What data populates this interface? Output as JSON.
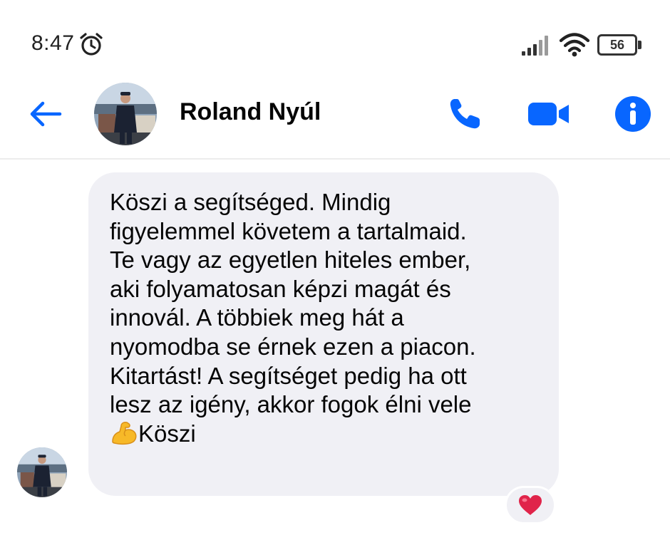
{
  "status_bar": {
    "time": "8:47",
    "battery": "56",
    "icons": [
      "alarm-icon",
      "signal-icon",
      "wifi-icon",
      "battery-icon"
    ]
  },
  "header": {
    "contact_name": "Roland Nyúl",
    "icons": [
      "back-arrow-icon",
      "phone-icon",
      "video-camera-icon",
      "info-icon"
    ],
    "accent_color": "#0866ff"
  },
  "message": {
    "lines": [
      "Köszi a segítséged. Mindig",
      "figyelemmel követem a tartalmaid.",
      "Te vagy az egyetlen hiteles ember,",
      "aki folyamatosan képzi magát és",
      "innovál. A többiek meg hát a",
      "nyomodba se érnek ezen a piacon.",
      "Kitartást! A segítséget pedig ha ott",
      "lesz az igény, akkor fogok élni vele"
    ],
    "last_line_emoji": "flexed-biceps-emoji",
    "last_line": "Köszi",
    "bubble_color": "#f0f0f5",
    "reaction": "heart-emoji",
    "reaction_color": "#e0244a"
  }
}
